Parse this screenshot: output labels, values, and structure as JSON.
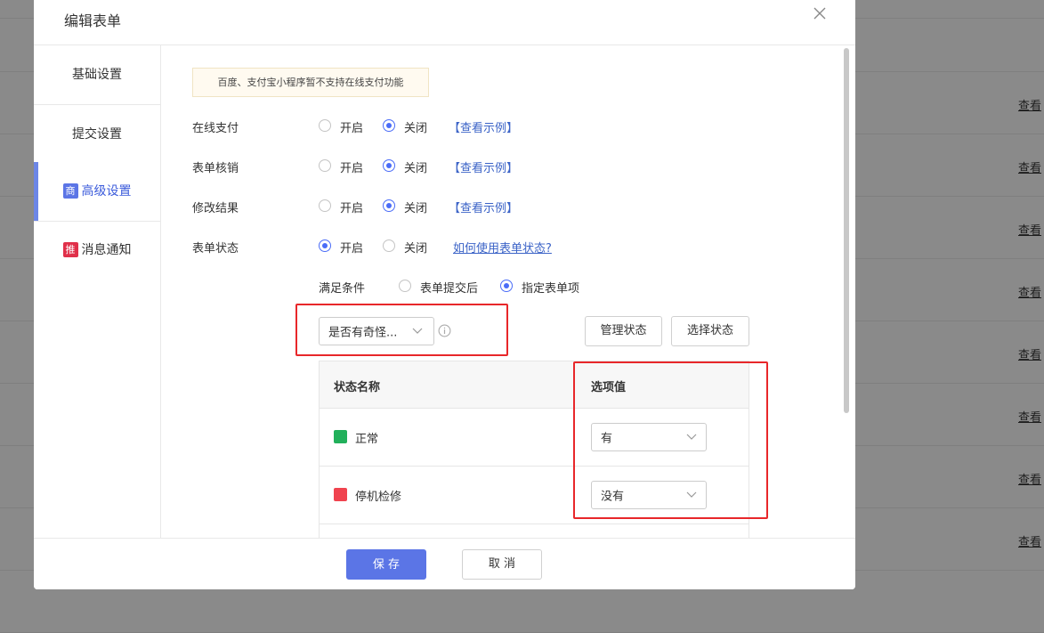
{
  "modal": {
    "title": "编辑表单",
    "close_icon": "close-icon"
  },
  "background": {
    "row_link": "查看"
  },
  "sidebar": {
    "items": [
      {
        "label": "基础设置"
      },
      {
        "label": "提交设置"
      },
      {
        "label": "高级设置",
        "badge": "商",
        "active": true
      },
      {
        "label": "消息通知",
        "badge": "推"
      }
    ]
  },
  "notice": "百度、支付宝小程序暂不支持在线支付功能",
  "settings": {
    "online_pay": {
      "label": "在线支付",
      "opt_on": "开启",
      "opt_off": "关闭",
      "selected": "关闭",
      "link": "【查看示例】"
    },
    "verify": {
      "label": "表单核销",
      "opt_on": "开启",
      "opt_off": "关闭",
      "selected": "关闭",
      "link": "【查看示例】"
    },
    "modify": {
      "label": "修改结果",
      "opt_on": "开启",
      "opt_off": "关闭",
      "selected": "关闭",
      "link": "【查看示例】"
    },
    "status": {
      "label": "表单状态",
      "opt_on": "开启",
      "opt_off": "关闭",
      "selected": "开启",
      "link": "如何使用表单状态?"
    }
  },
  "condition": {
    "label": "满足条件",
    "opt_after_submit": "表单提交后",
    "opt_specific": "指定表单项",
    "selected": "指定表单项",
    "field_select_value": "是否有奇怪...",
    "info_icon": "info-icon"
  },
  "buttons": {
    "manage_status": "管理状态",
    "choose_status": "选择状态",
    "save": "保 存",
    "cancel": "取 消"
  },
  "table": {
    "headers": [
      "状态名称",
      "选项值"
    ],
    "rows": [
      {
        "name": "正常",
        "color": "#22b05b",
        "value": "有"
      },
      {
        "name": "停机检修",
        "color": "#f0434f",
        "value": "没有"
      }
    ]
  },
  "colors": {
    "accent": "#4a6cf7",
    "primary_button": "#5b75e6",
    "highlight_box": "#e8272a"
  }
}
